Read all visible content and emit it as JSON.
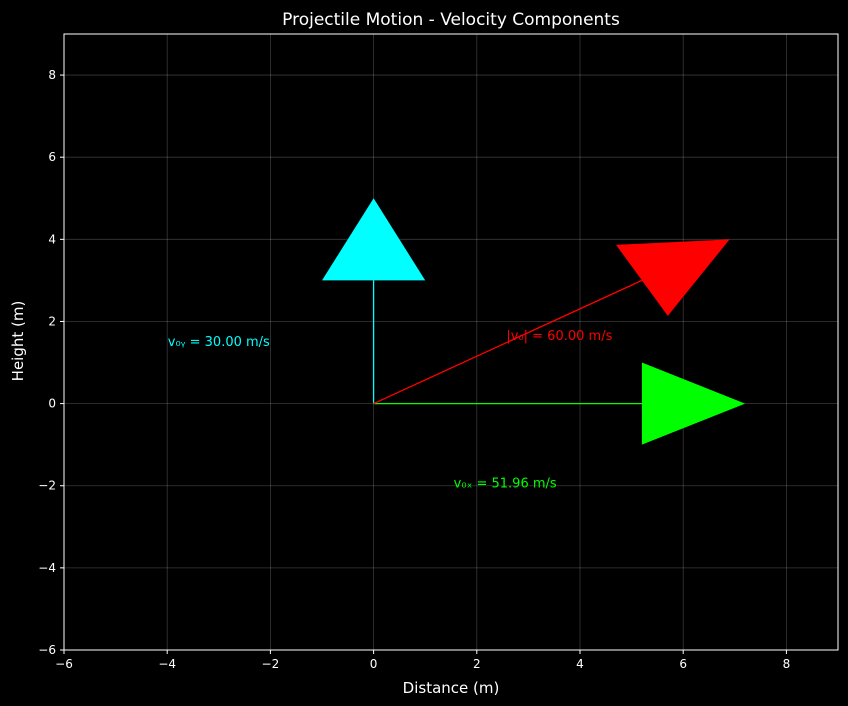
{
  "chart_data": {
    "type": "vector",
    "title": "Projectile Motion - Velocity Components",
    "xlabel": "Distance (m)",
    "ylabel": "Height (m)",
    "xlim": [
      -6,
      9
    ],
    "ylim": [
      -6,
      9
    ],
    "xticks": [
      -6,
      -4,
      -2,
      0,
      2,
      4,
      6,
      8
    ],
    "yticks": [
      -6,
      -4,
      -2,
      0,
      2,
      4,
      6,
      8
    ],
    "xtick_labels": [
      "−6",
      "−4",
      "−2",
      "0",
      "2",
      "4",
      "6",
      "8"
    ],
    "ytick_labels": [
      "−6",
      "−4",
      "−2",
      "0",
      "2",
      "4",
      "6",
      "8"
    ],
    "grid": true,
    "vectors": [
      {
        "id": "v0x",
        "color": "#00ff00",
        "tail": [
          0,
          0
        ],
        "tip": [
          7.2,
          0
        ],
        "head_base_center": [
          5.2,
          0
        ],
        "head_half_width": 1.0,
        "label": "v₀ₓ = 51.96 m/s",
        "label_pos": [
          2.55,
          -1.95
        ]
      },
      {
        "id": "v0y",
        "color": "#00ffff",
        "tail": [
          0,
          0
        ],
        "tip": [
          0,
          5.0
        ],
        "head_base_center": [
          0,
          3.0
        ],
        "head_half_width": 1.0,
        "label": "v₀ᵧ = 30.00 m/s",
        "label_pos": [
          -3.0,
          1.5
        ]
      },
      {
        "id": "v0",
        "color": "#ff0000",
        "tail": [
          0,
          0
        ],
        "tip": [
          6.9,
          4.0
        ],
        "head_base_center": [
          5.2,
          3.0
        ],
        "head_half_width": 1.0,
        "label": "|v₀| = 60.00 m/s",
        "label_pos": [
          3.6,
          1.65
        ]
      }
    ]
  }
}
